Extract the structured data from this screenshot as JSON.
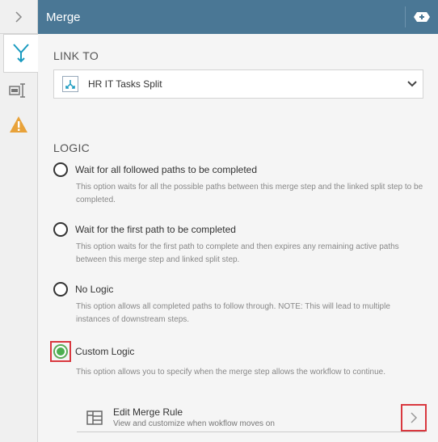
{
  "header": {
    "title": "Merge"
  },
  "link_to": {
    "label": "LINK TO",
    "selected": "HR IT Tasks Split"
  },
  "logic": {
    "label": "LOGIC",
    "options": [
      {
        "title": "Wait for all followed paths to be completed",
        "desc": "This option waits for all the possible paths between this merge step and the linked split step to be completed."
      },
      {
        "title": "Wait for the first path to be completed",
        "desc": "This option waits for the first path to complete and then expires any remaining active paths between this merge step and linked split step."
      },
      {
        "title": "No Logic",
        "desc": "This option allows all completed paths to follow through. NOTE: This will lead to multiple instances of downstream steps."
      },
      {
        "title": "Custom Logic",
        "desc": "This option allows you to specify when the merge step allows the workflow to continue."
      }
    ],
    "selected_index": 3
  },
  "rule": {
    "title": "Edit Merge Rule",
    "subtitle": "View and customize when wokflow moves on"
  },
  "colors": {
    "header_bg": "#4a7795",
    "accent_teal": "#1a9bc0",
    "warning": "#e8a23a",
    "radio_selected": "#4caf50",
    "highlight": "#d9383f"
  }
}
